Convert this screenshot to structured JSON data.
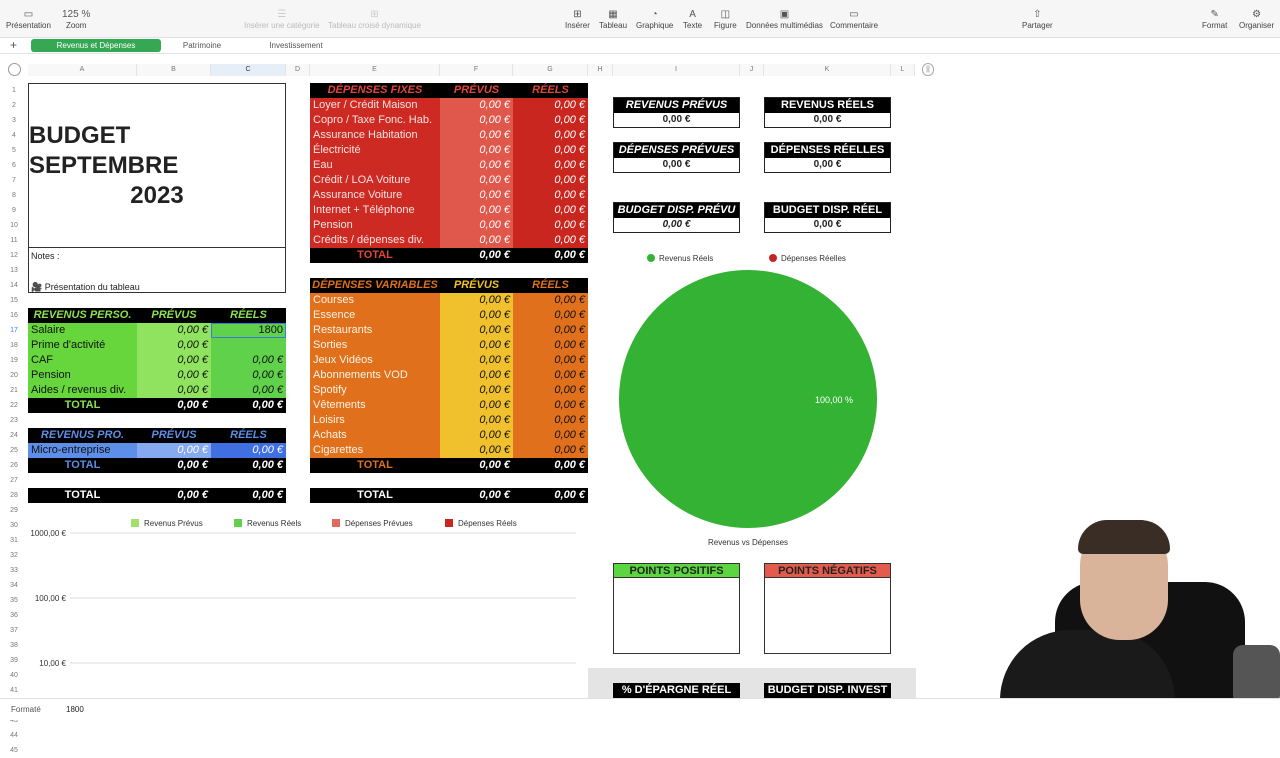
{
  "toolbar": {
    "presentation": "Présentation",
    "zoom_value": "125 %",
    "zoom": "Zoom",
    "category": "Insérer une catégorie",
    "pivot": "Tableau croisé dynamique",
    "insert": "Insérer",
    "table": "Tableau",
    "chart": "Graphique",
    "text": "Texte",
    "shape": "Figure",
    "media": "Données multimédias",
    "comment": "Commentaire",
    "share": "Partager",
    "format": "Format",
    "organize": "Organiser"
  },
  "sheets": [
    "Revenus et Dépenses",
    "Patrimoine",
    "Investissement"
  ],
  "columns": [
    "A",
    "B",
    "C",
    "D",
    "E",
    "F",
    "G",
    "H",
    "I",
    "J",
    "K",
    "L"
  ],
  "rows": [
    "1",
    "2",
    "3",
    "4",
    "5",
    "6",
    "7",
    "8",
    "9",
    "10",
    "11",
    "12",
    "13",
    "14",
    "15",
    "16",
    "17",
    "18",
    "19",
    "20",
    "21",
    "22",
    "23",
    "24",
    "25",
    "26",
    "27",
    "28",
    "29",
    "30",
    "31",
    "32",
    "33",
    "34",
    "35",
    "36",
    "37",
    "38",
    "39",
    "40",
    "41",
    "42",
    "43",
    "44",
    "45"
  ],
  "title": {
    "line1": "BUDGET SEPTEMBRE",
    "line2": "2023"
  },
  "notes": {
    "label": "Notes :",
    "video": "Présentation du tableau"
  },
  "revperso": {
    "header": "REVENUS PERSO.",
    "prevus": "PRÉVUS",
    "reels": "RÉELS",
    "items": [
      {
        "label": "Salaire",
        "prevu": "0,00 €",
        "reel": "1800"
      },
      {
        "label": "Prime d'activité",
        "prevu": "0,00 €",
        "reel": ""
      },
      {
        "label": "CAF",
        "prevu": "0,00 €",
        "reel": "0,00 €"
      },
      {
        "label": "Pension",
        "prevu": "0,00 €",
        "reel": "0,00 €"
      },
      {
        "label": "Aides / revenus div.",
        "prevu": "0,00 €",
        "reel": "0,00 €"
      }
    ],
    "total": {
      "label": "TOTAL",
      "prevu": "0,00 €",
      "reel": "0,00 €"
    }
  },
  "revpro": {
    "header": "REVENUS PRO.",
    "prevus": "PRÉVUS",
    "reels": "RÉELS",
    "items": [
      {
        "label": "Micro-entreprise",
        "prevu": "0,00 €",
        "reel": "0,00 €"
      }
    ],
    "total": {
      "label": "TOTAL",
      "prevu": "0,00 €",
      "reel": "0,00 €"
    }
  },
  "grandtotal_left": {
    "label": "TOTAL",
    "prevu": "0,00 €",
    "reel": "0,00 €"
  },
  "fixes": {
    "header": "DÉPENSES FIXES",
    "prevus": "PRÉVUS",
    "reels": "RÉELS",
    "items": [
      {
        "label": "Loyer / Crédit Maison",
        "prevu": "0,00 €",
        "reel": "0,00 €"
      },
      {
        "label": "Copro / Taxe Fonc. Hab.",
        "prevu": "0,00 €",
        "reel": "0,00 €"
      },
      {
        "label": "Assurance Habitation",
        "prevu": "0,00 €",
        "reel": "0,00 €"
      },
      {
        "label": "Électricité",
        "prevu": "0,00 €",
        "reel": "0,00 €"
      },
      {
        "label": "Eau",
        "prevu": "0,00 €",
        "reel": "0,00 €"
      },
      {
        "label": "Crédit / LOA Voiture",
        "prevu": "0,00 €",
        "reel": "0,00 €"
      },
      {
        "label": "Assurance Voiture",
        "prevu": "0,00 €",
        "reel": "0,00 €"
      },
      {
        "label": "Internet + Téléphone",
        "prevu": "0,00 €",
        "reel": "0,00 €"
      },
      {
        "label": "Pension",
        "prevu": "0,00 €",
        "reel": "0,00 €"
      },
      {
        "label": "Crédits / dépenses div.",
        "prevu": "0,00 €",
        "reel": "0,00 €"
      }
    ],
    "total": {
      "label": "TOTAL",
      "prevu": "0,00 €",
      "reel": "0,00 €"
    }
  },
  "variables": {
    "header": "DÉPENSES VARIABLES",
    "prevus": "PRÉVUS",
    "reels": "RÉELS",
    "items": [
      {
        "label": "Courses",
        "prevu": "0,00 €",
        "reel": "0,00 €"
      },
      {
        "label": "Essence",
        "prevu": "0,00 €",
        "reel": "0,00 €"
      },
      {
        "label": "Restaurants",
        "prevu": "0,00 €",
        "reel": "0,00 €"
      },
      {
        "label": "Sorties",
        "prevu": "0,00 €",
        "reel": "0,00 €"
      },
      {
        "label": "Jeux Vidéos",
        "prevu": "0,00 €",
        "reel": "0,00 €"
      },
      {
        "label": "Abonnements VOD",
        "prevu": "0,00 €",
        "reel": "0,00 €"
      },
      {
        "label": "Spotify",
        "prevu": "0,00 €",
        "reel": "0,00 €"
      },
      {
        "label": "Vêtements",
        "prevu": "0,00 €",
        "reel": "0,00 €"
      },
      {
        "label": "Loisirs",
        "prevu": "0,00 €",
        "reel": "0,00 €"
      },
      {
        "label": "Achats",
        "prevu": "0,00 €",
        "reel": "0,00 €"
      },
      {
        "label": "Cigarettes",
        "prevu": "0,00 €",
        "reel": "0,00 €"
      }
    ],
    "total": {
      "label": "TOTAL",
      "prevu": "0,00 €",
      "reel": "0,00 €"
    }
  },
  "grandtotal_mid": {
    "label": "TOTAL",
    "prevu": "0,00 €",
    "reel": "0,00 €"
  },
  "kpis": {
    "rev_prevus": {
      "label": "REVENUS PRÉVUS",
      "value": "0,00 €"
    },
    "rev_reels": {
      "label": "REVENUS RÉELS",
      "value": "0,00 €"
    },
    "dep_prevues": {
      "label": "DÉPENSES PRÉVUES",
      "value": "0,00 €"
    },
    "dep_reelles": {
      "label": "DÉPENSES RÉELLES",
      "value": "0,00 €"
    },
    "budget_prevu": {
      "label": "BUDGET DISP. PRÉVU",
      "value": "0,00 €"
    },
    "budget_reel": {
      "label": "BUDGET DISP. RÉEL",
      "value": "0,00 €"
    }
  },
  "points": {
    "positifs": "POINTS POSITIFS",
    "negatifs": "POINTS NÉGATIFS"
  },
  "bottom": {
    "epargne": "% D'ÉPARGNE RÉEL",
    "invest": "BUDGET DISP. INVEST"
  },
  "colors": {
    "green": "#33b233",
    "red": "#c42424",
    "fixes": "#cc2a23",
    "orange": "#e0701c",
    "yellow": "#f0c12c",
    "lightgreen": "#8ae34f",
    "blue": "#5d8ee8"
  },
  "status": {
    "label": "Formaté",
    "value": "1800"
  },
  "chart_data": [
    {
      "type": "bar",
      "legend": [
        "Revenus Prévus",
        "Revenus Réels",
        "Dépenses Prévues",
        "Dépenses Réels"
      ],
      "legend_colors": [
        "#9de36a",
        "#5fd14a",
        "#e06a5e",
        "#c8261f"
      ],
      "y_ticks": [
        "1000,00 €",
        "100,00 €",
        "10,00 €"
      ],
      "log_scale": true,
      "series": []
    },
    {
      "type": "pie",
      "title": "Revenus vs Dépenses",
      "legend": [
        "Revenus Réels",
        "Dépenses Réelles"
      ],
      "legend_colors": [
        "#33b233",
        "#c42424"
      ],
      "values": [
        100,
        0
      ],
      "labels": [
        "100,00 %",
        ""
      ]
    }
  ]
}
